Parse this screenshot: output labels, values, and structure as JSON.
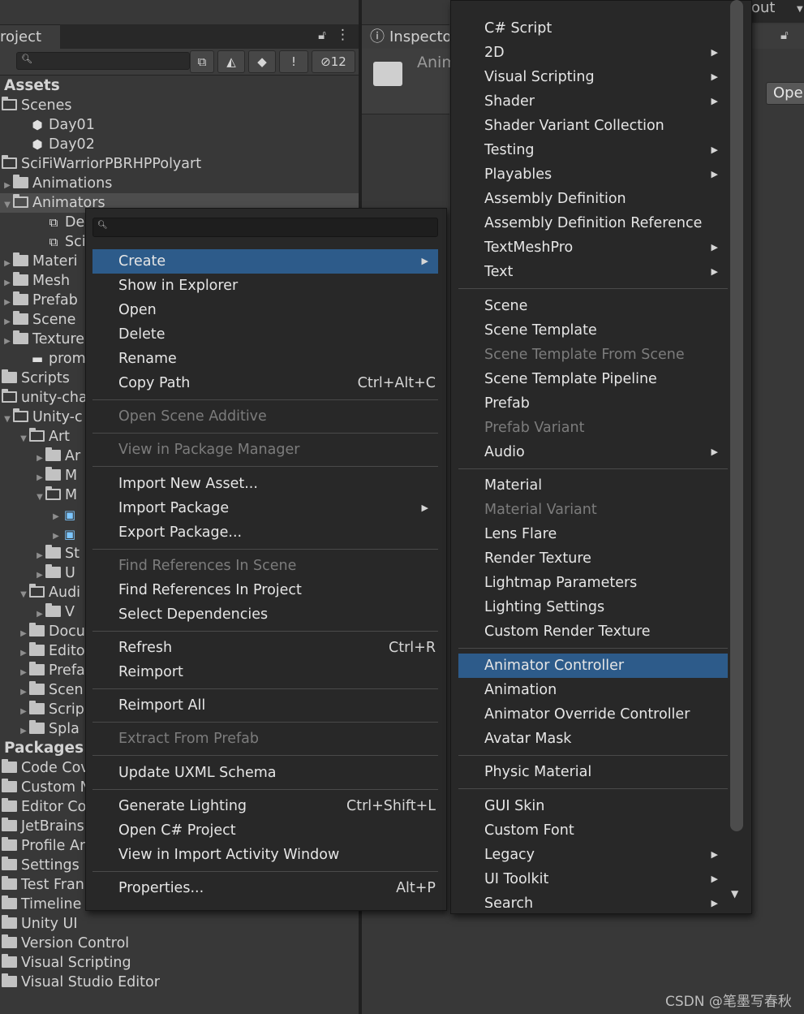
{
  "project": {
    "tab_label": "roject",
    "tree": [
      {
        "label": "Assets",
        "header": true,
        "depth": 0
      },
      {
        "label": "Scenes",
        "icon": "folder-open",
        "depth": 0,
        "arrow": false
      },
      {
        "label": "Day01",
        "icon": "unity-scene",
        "depth": 1
      },
      {
        "label": "Day02",
        "icon": "unity-scene",
        "depth": 1
      },
      {
        "label": "SciFiWarriorPBRHPPolyart",
        "icon": "folder-open",
        "depth": 0,
        "arrow": false
      },
      {
        "label": "Animations",
        "icon": "folder",
        "depth": 0,
        "arrow": "right"
      },
      {
        "label": "Animators",
        "icon": "folder-open",
        "depth": 0,
        "arrow": "down",
        "selected": true
      },
      {
        "label": "Dem",
        "icon": "animator",
        "depth": 2
      },
      {
        "label": "SciF",
        "icon": "animator",
        "depth": 2
      },
      {
        "label": "Materi",
        "icon": "folder",
        "depth": 0,
        "arrow": "right"
      },
      {
        "label": "Mesh",
        "icon": "folder",
        "depth": 0,
        "arrow": "right"
      },
      {
        "label": "Prefab",
        "icon": "folder",
        "depth": 0,
        "arrow": "right"
      },
      {
        "label": "Scene",
        "icon": "folder",
        "depth": 0,
        "arrow": "right"
      },
      {
        "label": "Texture",
        "icon": "folder",
        "depth": 0,
        "arrow": "right"
      },
      {
        "label": "promot",
        "icon": "texture",
        "depth": 1
      },
      {
        "label": "Scripts",
        "icon": "folder",
        "depth": 0,
        "arrow": false
      },
      {
        "label": "unity-cha",
        "icon": "folder-open",
        "depth": 0,
        "arrow": false
      },
      {
        "label": "Unity-c",
        "icon": "folder-open",
        "depth": 0,
        "arrow": "down"
      },
      {
        "label": "Art",
        "icon": "folder-open",
        "depth": 1,
        "arrow": "down"
      },
      {
        "label": "Ar",
        "icon": "folder",
        "depth": 2,
        "arrow": "right"
      },
      {
        "label": "M",
        "icon": "folder",
        "depth": 2,
        "arrow": "right"
      },
      {
        "label": "M",
        "icon": "folder-open",
        "depth": 2,
        "arrow": "down"
      },
      {
        "label": "",
        "icon": "model",
        "depth": 3,
        "arrow": "right"
      },
      {
        "label": "",
        "icon": "model",
        "depth": 3,
        "arrow": "right"
      },
      {
        "label": "St",
        "icon": "folder",
        "depth": 2,
        "arrow": "right"
      },
      {
        "label": "U",
        "icon": "folder",
        "depth": 2,
        "arrow": "right"
      },
      {
        "label": "Audi",
        "icon": "folder-open",
        "depth": 1,
        "arrow": "down"
      },
      {
        "label": "V",
        "icon": "folder",
        "depth": 2,
        "arrow": "right"
      },
      {
        "label": "Docu",
        "icon": "folder",
        "depth": 1,
        "arrow": "right"
      },
      {
        "label": "Edito",
        "icon": "folder",
        "depth": 1,
        "arrow": "right"
      },
      {
        "label": "Prefa",
        "icon": "folder",
        "depth": 1,
        "arrow": "right"
      },
      {
        "label": "Scen",
        "icon": "folder",
        "depth": 1,
        "arrow": "right"
      },
      {
        "label": "Scrip",
        "icon": "folder",
        "depth": 1,
        "arrow": "right"
      },
      {
        "label": "Spla",
        "icon": "folder",
        "depth": 1,
        "arrow": "right"
      },
      {
        "label": "Packages",
        "header": true,
        "depth": 0
      },
      {
        "label": "Code Cov",
        "icon": "folder",
        "depth": 0,
        "arrow": false
      },
      {
        "label": "Custom N",
        "icon": "folder",
        "depth": 0,
        "arrow": false
      },
      {
        "label": "Editor Co",
        "icon": "folder",
        "depth": 0,
        "arrow": false
      },
      {
        "label": "JetBrains",
        "icon": "folder",
        "depth": 0,
        "arrow": false
      },
      {
        "label": "Profile Ar",
        "icon": "folder",
        "depth": 0,
        "arrow": false
      },
      {
        "label": "Settings I",
        "icon": "folder",
        "depth": 0,
        "arrow": false
      },
      {
        "label": "Test Fran",
        "icon": "folder",
        "depth": 0,
        "arrow": false
      },
      {
        "label": "Timeline",
        "icon": "folder",
        "depth": 0,
        "arrow": false
      },
      {
        "label": "Unity UI",
        "icon": "folder",
        "depth": 0,
        "arrow": false
      },
      {
        "label": "Version Control",
        "icon": "folder",
        "depth": 0,
        "arrow": false
      },
      {
        "label": "Visual Scripting",
        "icon": "folder",
        "depth": 0,
        "arrow": false
      },
      {
        "label": "Visual Studio Editor",
        "icon": "folder",
        "depth": 0,
        "arrow": false
      }
    ],
    "toolbar": {
      "hidden_count": "12"
    }
  },
  "inspector": {
    "tab_label": "Inspecto",
    "title": "Anim"
  },
  "right_panel": {
    "tab_label": "out",
    "open_label": "Oper"
  },
  "context_menu": {
    "items": [
      {
        "label": "Create",
        "submenu": true,
        "highlighted": true
      },
      {
        "label": "Show in Explorer"
      },
      {
        "label": "Open"
      },
      {
        "label": "Delete"
      },
      {
        "label": "Rename"
      },
      {
        "label": "Copy Path",
        "shortcut": "Ctrl+Alt+C"
      },
      {
        "sep": true
      },
      {
        "label": "Open Scene Additive",
        "disabled": true
      },
      {
        "sep": true
      },
      {
        "label": "View in Package Manager",
        "disabled": true
      },
      {
        "sep": true
      },
      {
        "label": "Import New Asset..."
      },
      {
        "label": "Import Package",
        "submenu": true
      },
      {
        "label": "Export Package..."
      },
      {
        "sep": true
      },
      {
        "label": "Find References In Scene",
        "disabled": true
      },
      {
        "label": "Find References In Project"
      },
      {
        "label": "Select Dependencies"
      },
      {
        "sep": true
      },
      {
        "label": "Refresh",
        "shortcut": "Ctrl+R"
      },
      {
        "label": "Reimport"
      },
      {
        "sep": true
      },
      {
        "label": "Reimport All"
      },
      {
        "sep": true
      },
      {
        "label": "Extract From Prefab",
        "disabled": true
      },
      {
        "sep": true
      },
      {
        "label": "Update UXML Schema"
      },
      {
        "sep": true
      },
      {
        "label": "Generate Lighting",
        "shortcut": "Ctrl+Shift+L"
      },
      {
        "label": "Open C# Project"
      },
      {
        "label": "View in Import Activity Window"
      },
      {
        "sep": true
      },
      {
        "label": "Properties...",
        "shortcut": "Alt+P"
      }
    ]
  },
  "submenu": {
    "items": [
      {
        "label": "C# Script"
      },
      {
        "label": "2D",
        "submenu": true
      },
      {
        "label": "Visual Scripting",
        "submenu": true
      },
      {
        "label": "Shader",
        "submenu": true
      },
      {
        "label": "Shader Variant Collection"
      },
      {
        "label": "Testing",
        "submenu": true
      },
      {
        "label": "Playables",
        "submenu": true
      },
      {
        "label": "Assembly Definition"
      },
      {
        "label": "Assembly Definition Reference"
      },
      {
        "label": "TextMeshPro",
        "submenu": true
      },
      {
        "label": "Text",
        "submenu": true
      },
      {
        "sep": true
      },
      {
        "label": "Scene"
      },
      {
        "label": "Scene Template"
      },
      {
        "label": "Scene Template From Scene",
        "disabled": true
      },
      {
        "label": "Scene Template Pipeline"
      },
      {
        "label": "Prefab"
      },
      {
        "label": "Prefab Variant",
        "disabled": true
      },
      {
        "label": "Audio",
        "submenu": true
      },
      {
        "sep": true
      },
      {
        "label": "Material"
      },
      {
        "label": "Material Variant",
        "disabled": true
      },
      {
        "label": "Lens Flare"
      },
      {
        "label": "Render Texture"
      },
      {
        "label": "Lightmap Parameters"
      },
      {
        "label": "Lighting Settings"
      },
      {
        "label": "Custom Render Texture"
      },
      {
        "sep": true
      },
      {
        "label": "Animator Controller",
        "highlighted": true
      },
      {
        "label": "Animation"
      },
      {
        "label": "Animator Override Controller"
      },
      {
        "label": "Avatar Mask"
      },
      {
        "sep": true
      },
      {
        "label": "Physic Material"
      },
      {
        "sep": true
      },
      {
        "label": "GUI Skin"
      },
      {
        "label": "Custom Font"
      },
      {
        "label": "Legacy",
        "submenu": true
      },
      {
        "label": "UI Toolkit",
        "submenu": true
      },
      {
        "label": "Search",
        "submenu": true
      }
    ]
  },
  "watermark": "CSDN @笔墨写春秋",
  "colors": {
    "highlight": "#2d5b8a",
    "menu_bg": "#282828",
    "panel_bg": "#383838"
  }
}
